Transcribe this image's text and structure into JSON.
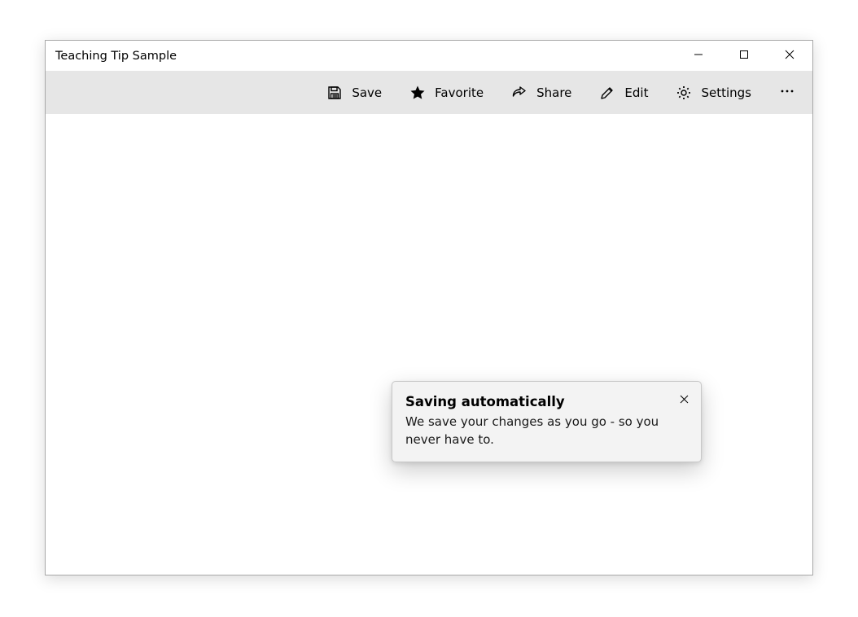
{
  "window": {
    "title": "Teaching Tip Sample"
  },
  "commandbar": {
    "save": "Save",
    "favorite": "Favorite",
    "share": "Share",
    "edit": "Edit",
    "settings": "Settings"
  },
  "teaching_tip": {
    "title": "Saving automatically",
    "body": "We save your changes as you go - so you never have to."
  }
}
